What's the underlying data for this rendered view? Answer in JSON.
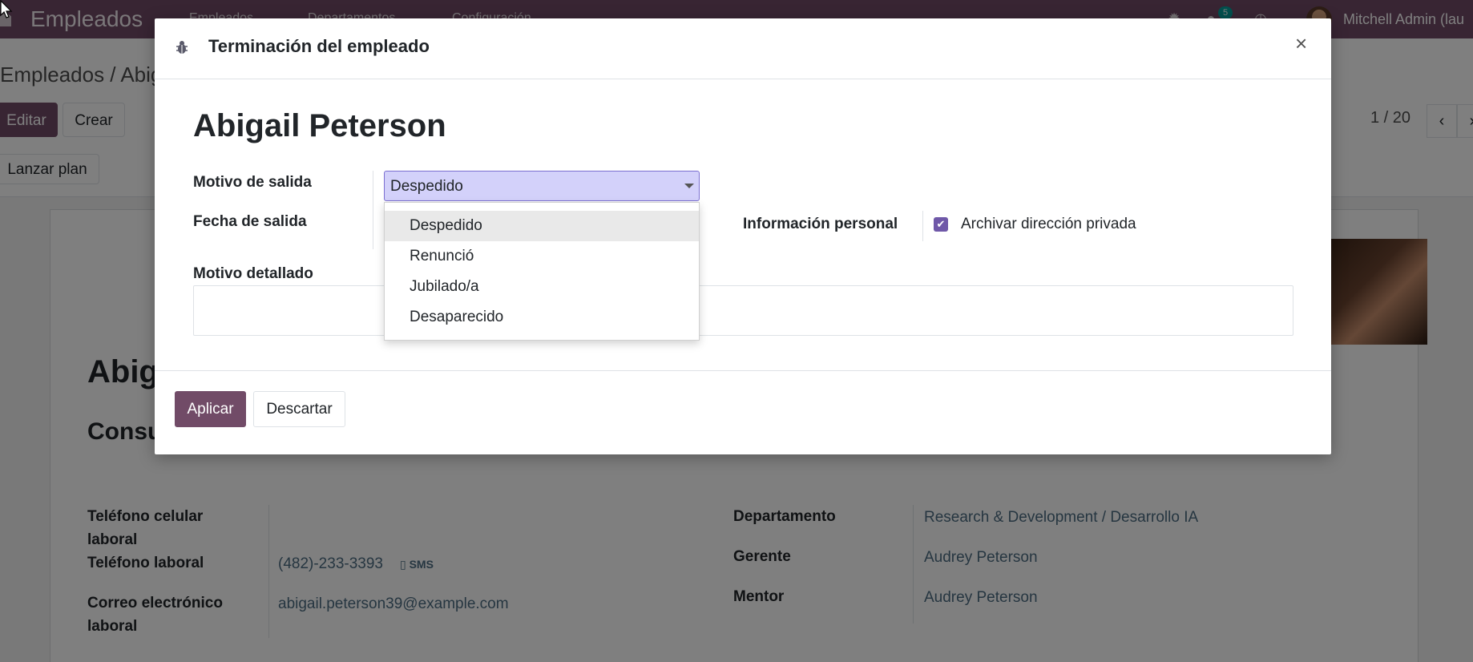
{
  "navbar": {
    "app_name": "Empleados",
    "menus": [
      "Empleados",
      "Departamentos",
      "Configuración"
    ],
    "chat_badge": "5",
    "user_name": "Mitchell Admin (lau"
  },
  "control": {
    "breadcrumb": "Empleados / Abig",
    "edit_label": "Editar",
    "create_label": "Crear",
    "launch_plan_label": "Lanzar plan",
    "pager": "1 / 20"
  },
  "sheet": {
    "name": "Abig",
    "job": "Consu",
    "left_fields": [
      {
        "label": "Teléfono celular laboral",
        "value": ""
      },
      {
        "label": "Teléfono laboral",
        "value": "(482)-233-3393"
      },
      {
        "label": "Correo electrónico laboral",
        "value": "abigail.peterson39@example.com"
      }
    ],
    "sms_label": "SMS",
    "right_fields": [
      {
        "label": "Departamento",
        "value": "Research & Development / Desarrollo IA"
      },
      {
        "label": "Gerente",
        "value": "Audrey Peterson"
      },
      {
        "label": "Mentor",
        "value": "Audrey Peterson"
      }
    ]
  },
  "modal": {
    "title": "Terminación del empleado",
    "employee_name": "Abigail Peterson",
    "labels": {
      "reason": "Motivo de salida",
      "date": "Fecha de salida",
      "detailed": "Motivo detallado",
      "personal": "Información personal"
    },
    "reason_value": "Despedido",
    "reason_options": [
      "Despedido",
      "Renunció",
      "Jubilado/a",
      "Desaparecido"
    ],
    "archive_label": "Archivar dirección privada",
    "archive_checked": true,
    "apply_label": "Aplicar",
    "discard_label": "Descartar",
    "close_symbol": "×"
  },
  "colors": {
    "brand": "#714b67",
    "select_highlight": "#d3d1fa",
    "checkbox": "#6f58a8",
    "badge": "#00a09d"
  }
}
